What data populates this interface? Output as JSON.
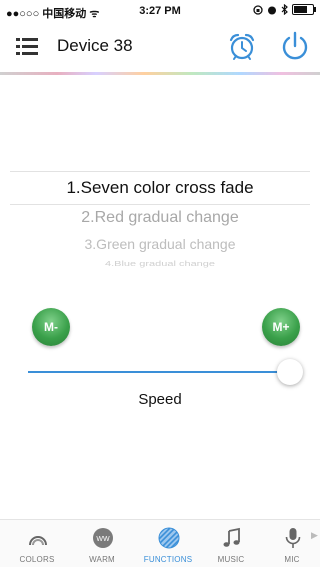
{
  "status_bar": {
    "carrier": "●●○○○ 中国移动 ᯤ",
    "time": "3:27 PM"
  },
  "header": {
    "title": "Device 38",
    "icons": [
      "menu-icon",
      "alarm-icon",
      "power-icon"
    ]
  },
  "function_list": {
    "items": [
      "1.Seven color cross fade",
      "2.Red  gradual change",
      "3.Green gradual change",
      "4.Blue gradual change"
    ],
    "selected_index": 0
  },
  "controls": {
    "mode_minus_label": "M-",
    "mode_plus_label": "M+",
    "speed_label": "Speed",
    "speed_value_fraction": 1.0
  },
  "tabs": [
    {
      "label": "COLORS",
      "icon": "dome-icon"
    },
    {
      "label": "WARM",
      "icon": "ww-icon",
      "icon_text": "WW"
    },
    {
      "label": "FUNCTIONS",
      "icon": "striped-circle-icon",
      "active": true
    },
    {
      "label": "MUSIC",
      "icon": "music-note-icon"
    },
    {
      "label": "MIC",
      "icon": "microphone-icon"
    }
  ],
  "colors": {
    "accent": "#3a8fd8",
    "button_green": "#3aa04a"
  }
}
